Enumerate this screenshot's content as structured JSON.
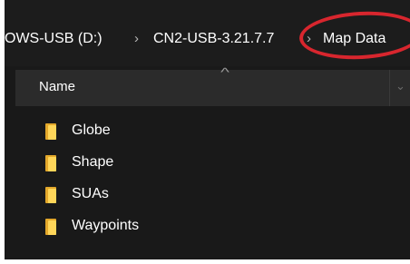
{
  "breadcrumb": {
    "segments": [
      "OWS-USB (D:)",
      "CN2-USB-3.21.7.7",
      "Map Data"
    ],
    "separator": "›"
  },
  "file_list": {
    "column_header": "Name",
    "sort_glyph": "^",
    "dropdown_glyph": "⌄",
    "items": [
      {
        "name": "Globe",
        "icon": "folder-icon"
      },
      {
        "name": "Shape",
        "icon": "folder-icon"
      },
      {
        "name": "SUAs",
        "icon": "folder-icon"
      },
      {
        "name": "Waypoints",
        "icon": "folder-icon"
      }
    ]
  },
  "colors": {
    "highlight_ring": "#d8262e",
    "folder": "#ffd659",
    "background": "#202020"
  }
}
